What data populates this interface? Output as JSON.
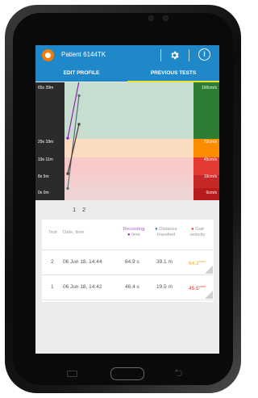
{
  "app": {
    "patient": "Patient 6144TK"
  },
  "tabs": [
    {
      "label": "EDIT PROFILE",
      "active": false
    },
    {
      "label": "PREVIOUS TESTS",
      "active": true
    }
  ],
  "chart_data": {
    "type": "line",
    "left_labels": [
      "65s 39m",
      "29s 18m",
      "19s 11m",
      "8s 5m",
      "0s 0m"
    ],
    "right_labels": [
      "160cm/s",
      "72cm/s",
      "45cm/s",
      "19cm/s",
      "0cm/s"
    ],
    "band_colors": [
      "#2e7d32",
      "#fb8c00",
      "#e53935",
      "#c62828",
      "#b71c1c"
    ],
    "series": [
      {
        "color": "#8e24aa",
        "values": [
          46.4,
          64.9
        ]
      },
      {
        "color": "#546e7a",
        "values": [
          19.5,
          39.1
        ]
      },
      {
        "color": "#4e342e",
        "values": [
          45.5,
          64.3
        ]
      }
    ]
  },
  "pagination": [
    "1",
    "2"
  ],
  "table": {
    "headers": {
      "test": "Test",
      "date": "Date, time",
      "recording": "Recording",
      "recording_sub": "time",
      "distance": "Distance",
      "distance_sub": "travelled",
      "gait": "Gait",
      "gait_sub": "velocity"
    },
    "rows": [
      {
        "test": "2",
        "date": "06 Jun 18, 14:44",
        "time": "64.9 s",
        "distance": "39.1 m",
        "velocity": "64.3",
        "velocity_unit": "cm/s",
        "velocity_color": "#f5a623"
      },
      {
        "test": "1",
        "date": "06 Jun 18, 14:42",
        "time": "46.4 s",
        "distance": "19.5 m",
        "velocity": "45.5",
        "velocity_unit": "cm/s",
        "velocity_color": "#e53935"
      }
    ]
  },
  "colors": {
    "primary": "#1e88c9",
    "accent_indicator": "#f0e030",
    "recording": "#8e24aa",
    "distance": "#1e88c9",
    "gait": "#e53935"
  }
}
